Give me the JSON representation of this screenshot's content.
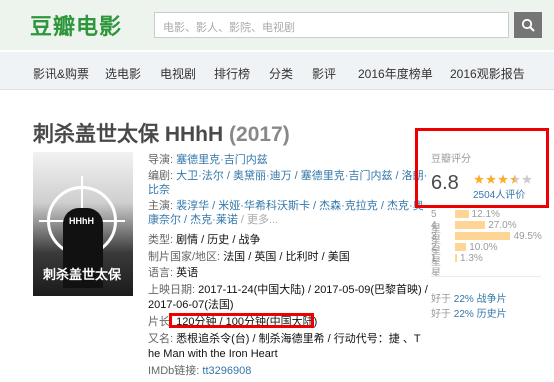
{
  "header": {
    "logo": "豆瓣电影",
    "search_placeholder": "电影、影人、影院、电视剧"
  },
  "nav": {
    "items": [
      "影讯&购票",
      "选电影",
      "电视剧",
      "排行榜",
      "分类",
      "影评",
      "2016年度榜单",
      "2016观影报告"
    ]
  },
  "movie": {
    "title": "刺杀盖世太保 HHhH",
    "year": "(2017)",
    "poster_text": "刺杀盖世太保",
    "poster_mark": "HHhH"
  },
  "info": {
    "director_label": "导演:",
    "director": "塞德里克·吉门内兹",
    "writer_label": "编剧:",
    "writer_1": "大卫·法尔 / 奥黛丽·迪万 / 塞德里克·吉门内兹 / 洛朗·",
    "writer_2": "比奈",
    "cast_label": "主演:",
    "cast_1": "裴淳华 / 米娅·华希科沃斯卡 / 杰森·克拉克 / 杰克·奥",
    "cast_2": "康奈尔 / 杰克·莱诺",
    "cast_more": "/ 更多...",
    "genre_label": "类型:",
    "genre": "剧情 / 历史 / 战争",
    "country_label": "制片国家/地区:",
    "country": "法国 / 英国 / 比利时 / 美国",
    "language_label": "语言:",
    "language": "英语",
    "release_label": "上映日期:",
    "release_1": "2017-11-24(中国大陆) / 2017-05-09(巴黎首映) /",
    "release_2": "2017-06-07(法国)",
    "runtime_label": "片长:",
    "runtime": "120分钟 / 100分钟(中国大陆)",
    "aka_label": "又名:",
    "aka_1": "悉根追杀令(台) / 制杀海德里希 / 行动代号：捷 、T",
    "aka_2": "he Man with the Iron Heart",
    "imdb_label": "IMDb链接:",
    "imdb": "tt3296908"
  },
  "rating": {
    "label": "豆瓣评分",
    "score": "6.8",
    "stars_value": 3.5,
    "stars_max": 5,
    "count": "2504人评价",
    "breakdown": [
      {
        "label": "5星",
        "pct": "12.1%",
        "value": 12.1
      },
      {
        "label": "4星",
        "pct": "27.0%",
        "value": 27.0
      },
      {
        "label": "3星",
        "pct": "49.5%",
        "value": 49.5
      },
      {
        "label": "2星",
        "pct": "10.0%",
        "value": 10.0
      },
      {
        "label": "1星",
        "pct": "1.3%",
        "value": 1.3
      }
    ],
    "better_1_prefix": "好于",
    "better_1_link": "22% 战争片",
    "better_2_prefix": "好于",
    "better_2_link": "22% 历史片"
  },
  "colors": {
    "brand_green": "#2e963d",
    "link_blue": "#3377aa",
    "highlight_red": "#ee0000",
    "star_orange": "#ffac2d",
    "bar_fill": "#ffd596"
  }
}
